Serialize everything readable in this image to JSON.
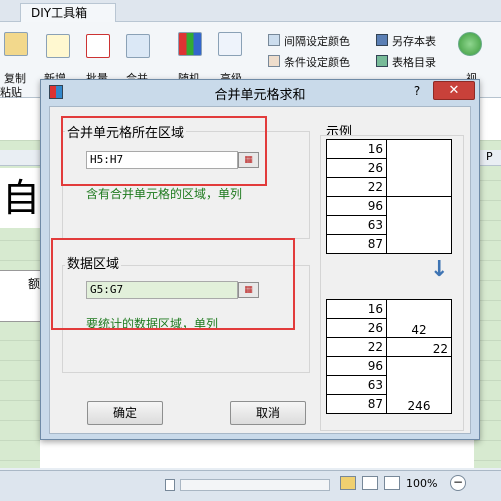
{
  "excel": {
    "tab_label": "DIY工具箱",
    "ribbon": {
      "copy_label": "复制",
      "paste_label": "粘贴",
      "new_label": "新增",
      "batch_label": "批量",
      "merge_label": "合并",
      "random_label": "随机",
      "advanced_label": "高级",
      "interval_color_label": "间隔设定颜色",
      "cond_color_label": "条件设定颜色",
      "save_as_label": "另存本表",
      "table_dir_label": "表格目录",
      "view_label": "视"
    },
    "sheet": {
      "big_char": "自",
      "cell_text": "额",
      "col_p": "P"
    },
    "status": {
      "zoom": "100%"
    }
  },
  "dialog": {
    "title": "合并单元格求和",
    "help": "?",
    "close": "✕",
    "merged_range": {
      "group_title": "合并单元格所在区域",
      "value": "H5:H7",
      "hint": "含有合并单元格的区域，单列"
    },
    "data_range": {
      "group_title": "数据区域",
      "value": "G5:G7",
      "hint": "要统计的数据区域，单列"
    },
    "ok_label": "确定",
    "cancel_label": "取消",
    "example": {
      "title": "示例",
      "before": [
        "16",
        "26",
        "22",
        "96",
        "63",
        "87"
      ],
      "after": [
        "16",
        "26",
        "22",
        "96",
        "63",
        "87"
      ],
      "sums": [
        "42",
        "22",
        "246"
      ],
      "arrow": "↓"
    }
  }
}
